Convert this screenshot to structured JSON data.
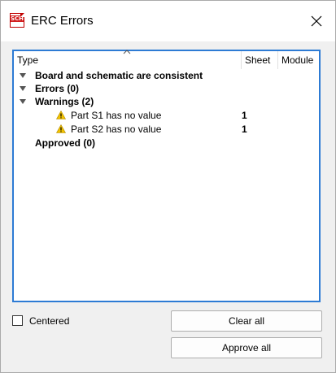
{
  "window": {
    "title": "ERC Errors",
    "app_icon_text": "SCH",
    "app_icon": "sch-file-icon",
    "close_icon": "close-icon"
  },
  "table": {
    "columns": [
      "Type",
      "Sheet",
      "Module"
    ],
    "sort_icon": "chevron-up-icon",
    "rows": [
      {
        "label": "Board and schematic are consistent",
        "expanded": true,
        "bold": true
      },
      {
        "label": "Errors (0)",
        "expanded": true,
        "bold": true
      },
      {
        "label": "Warnings (2)",
        "expanded": true,
        "bold": true
      },
      {
        "label": "Part S1 has no value",
        "sheet": "1",
        "icon": "warning-icon"
      },
      {
        "label": "Part S2 has no value",
        "sheet": "1",
        "icon": "warning-icon"
      },
      {
        "label": "Approved (0)",
        "expanded": false,
        "bold": true
      }
    ]
  },
  "footer": {
    "centered_label": "Centered",
    "centered_checked": false,
    "clear_all_label": "Clear all",
    "approve_all_label": "Approve all"
  },
  "colors": {
    "focus_border": "#2d7bd4",
    "warning": "#f2c200"
  }
}
